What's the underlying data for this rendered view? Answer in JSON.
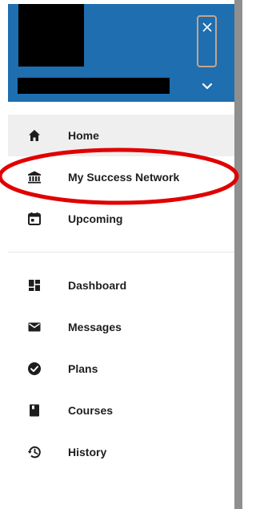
{
  "nav": {
    "primary": [
      {
        "label": "Home",
        "icon": "home-icon",
        "active": true
      },
      {
        "label": "My Success Network",
        "icon": "institution-icon",
        "active": false
      },
      {
        "label": "Upcoming",
        "icon": "calendar-icon",
        "active": false
      }
    ],
    "secondary": [
      {
        "label": "Dashboard",
        "icon": "dashboard-icon"
      },
      {
        "label": "Messages",
        "icon": "envelope-icon"
      },
      {
        "label": "Plans",
        "icon": "check-circle-icon"
      },
      {
        "label": "Courses",
        "icon": "book-icon"
      },
      {
        "label": "History",
        "icon": "history-icon"
      }
    ]
  },
  "colors": {
    "header": "#1e6eb0",
    "active_item": "#efefef",
    "annotation": "#e00000",
    "scrim": "#8f8f8f"
  }
}
